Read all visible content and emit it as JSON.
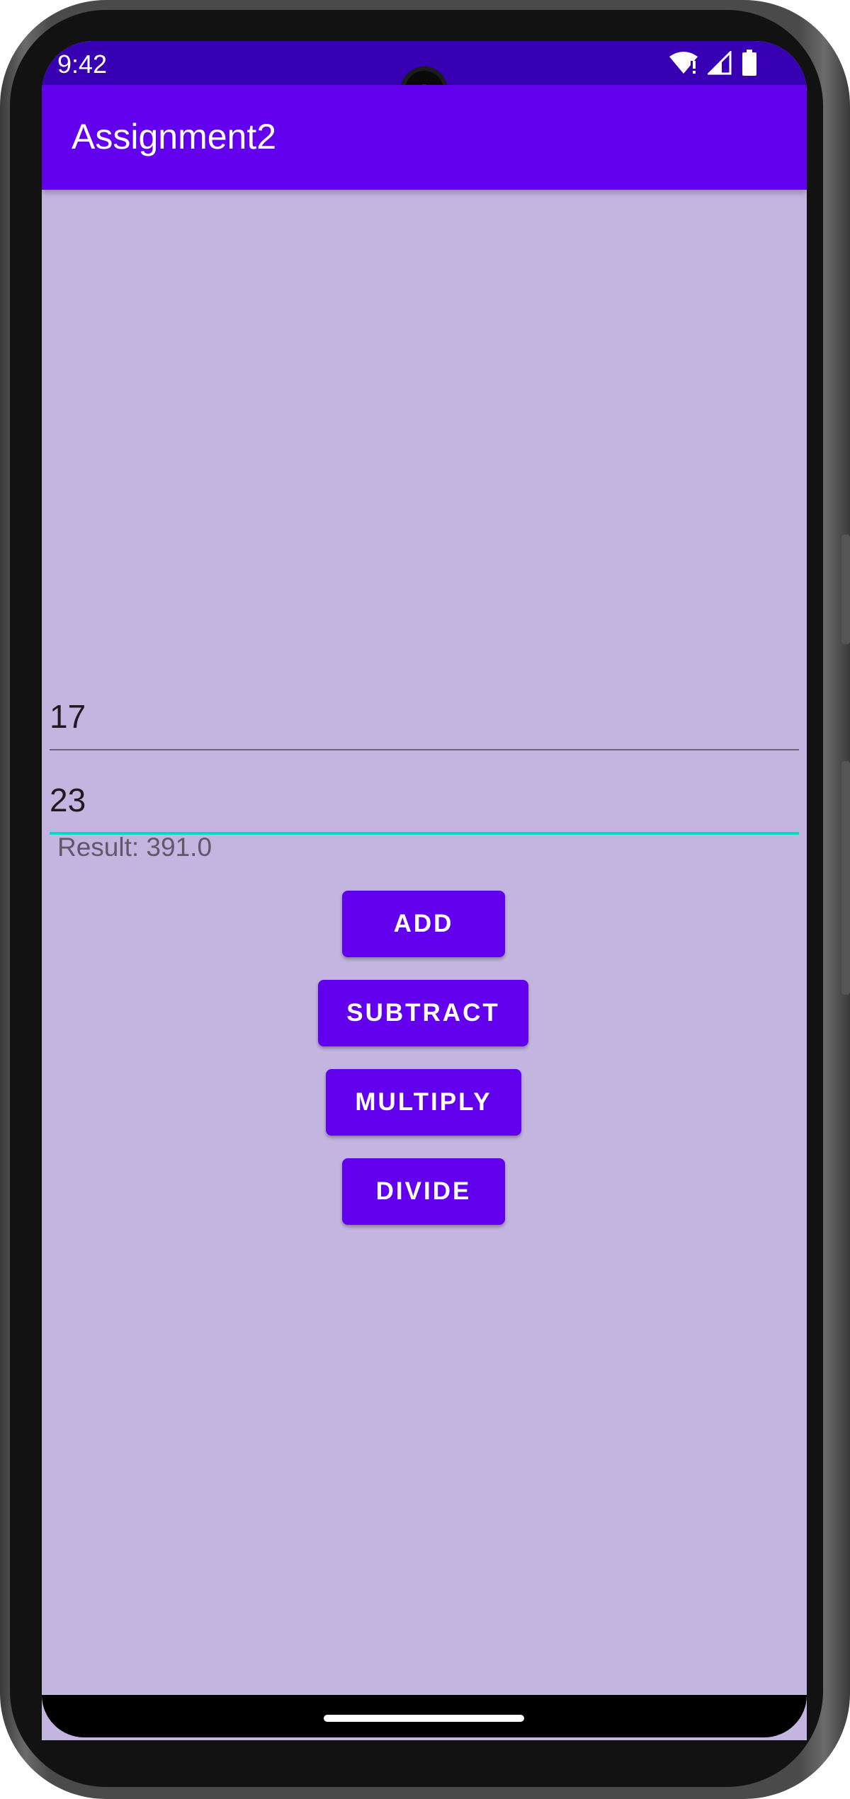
{
  "status_bar": {
    "time": "9:42",
    "icons": [
      "wifi-icon",
      "signal-icon",
      "battery-icon"
    ]
  },
  "app_bar": {
    "title": "Assignment2"
  },
  "inputs": {
    "first_number": "17",
    "second_number": "23"
  },
  "result_text": "Result: 391.0",
  "buttons": {
    "add": "ADD",
    "subtract": "SUBTRACT",
    "multiply": "MULTIPLY",
    "divide": "DIVIDE"
  },
  "colors": {
    "primary": "#6200ee",
    "primary_dark": "#3700b3",
    "background": "#c3b5df",
    "focus_underline": "#03dac5"
  }
}
